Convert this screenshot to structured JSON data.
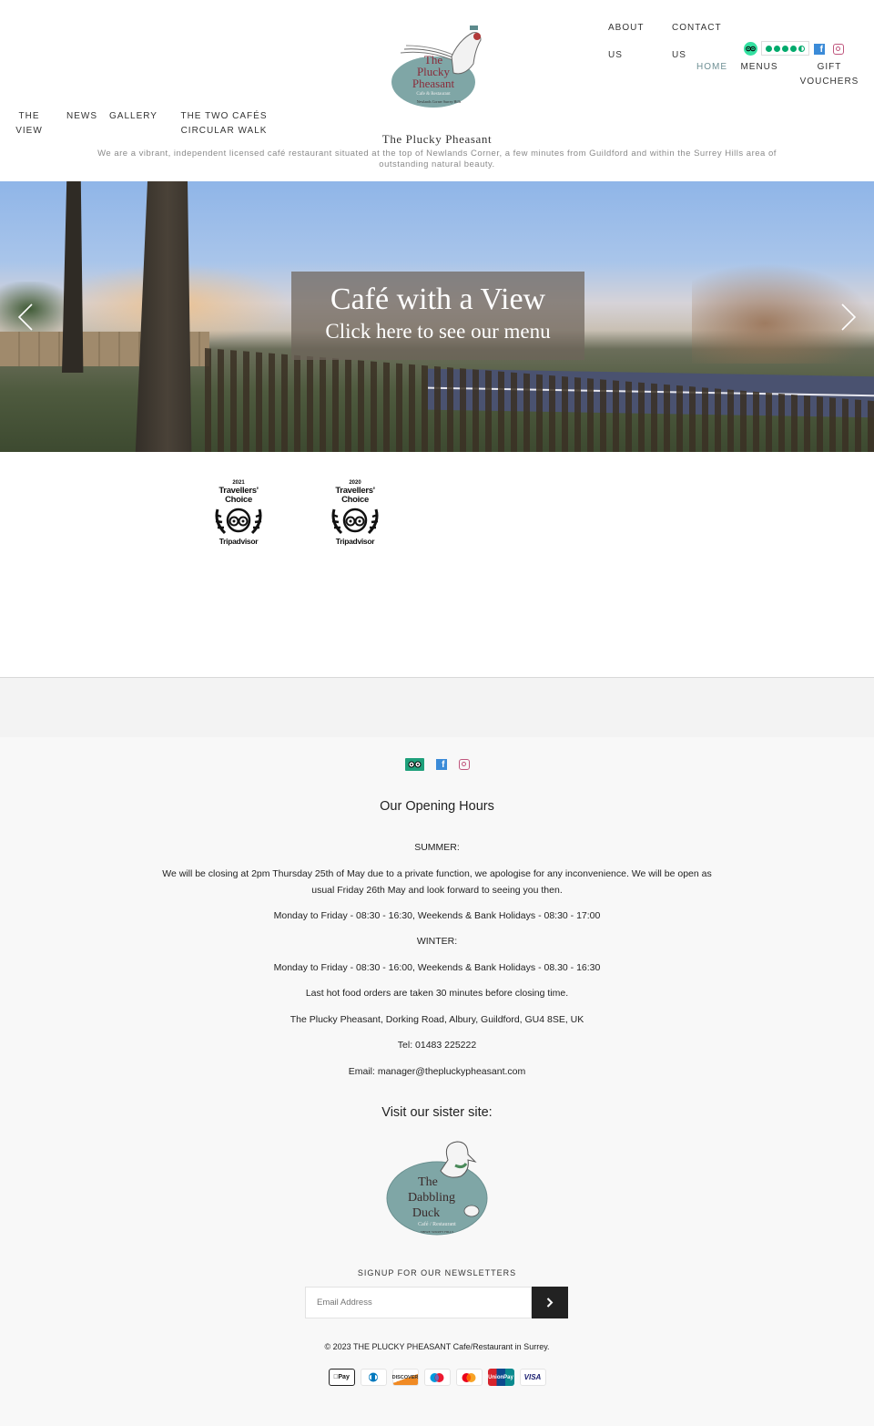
{
  "header": {
    "site_title": "The Plucky Pheasant",
    "description": "We are a vibrant, independent licensed café restaurant situated at the top of Newlands Corner, a few minutes from Guildford and within the Surrey Hills area of outstanding natural beauty.",
    "logo_alt": "The Plucky Pheasant Cafe & Restaurant",
    "nav_left": [
      {
        "line1": "THE",
        "line2": "VIEW"
      },
      {
        "line1": "NEWS",
        "line2": ""
      },
      {
        "line1": "GALLERY",
        "line2": ""
      },
      {
        "line1": "THE TWO CAFÉS",
        "line2": "CIRCULAR WALK"
      }
    ],
    "nav_right_top": [
      {
        "line1": "ABOUT",
        "line2": "US"
      },
      {
        "line1": "CONTACT",
        "line2": "US"
      }
    ],
    "nav_right_bottom": [
      {
        "line1": "HOME",
        "line2": "",
        "active": true
      },
      {
        "line1": "MENUS",
        "line2": ""
      },
      {
        "line1": "GIFT",
        "line2": "VOUCHERS"
      }
    ],
    "tripadvisor_rating": 4.5,
    "tripadvisor_rating_max": 5,
    "social_icons": [
      "tripadvisor-icon",
      "facebook-icon",
      "instagram-icon"
    ],
    "accent_color": "#6e8f94"
  },
  "hero": {
    "title": "Café with a View",
    "subtitle": "Click here to see our menu",
    "prev_label": "Previous slide",
    "next_label": "Next slide"
  },
  "awards": [
    {
      "year": "2021",
      "title_line1": "Travellers'",
      "title_line2": "Choice",
      "brand": "Tripadvisor"
    },
    {
      "year": "2020",
      "title_line1": "Travellers'",
      "title_line2": "Choice",
      "brand": "Tripadvisor"
    }
  ],
  "footer": {
    "opening_heading": "Our Opening Hours",
    "summer_label": "SUMMER:",
    "notice": "We will be closing at 2pm Thursday 25th of May due to a private function, we apologise for any inconvenience. We will be open as usual Friday 26th May and look forward to seeing you then.",
    "summer_hours": "Monday to Friday - 08:30 - 16:30, Weekends & Bank Holidays - 08:30 - 17:00",
    "winter_label": "WINTER:",
    "winter_hours": "Monday to Friday - 08:30 - 16:00, Weekends & Bank Holidays - 08.30 - 16:30",
    "last_orders": "Last hot food orders are taken 30 minutes before closing time.",
    "address": "The Plucky Pheasant, Dorking Road, Albury, Guildford, GU4 8SE, UK",
    "tel": "Tel: 01483 225222",
    "email": "Email: manager@thepluckypheasant.com",
    "sister_heading": "Visit our sister site:",
    "sister_logo_alt": "The Dabbling Duck Cafe / Restaurant",
    "newsletter_title": "SIGNUP FOR OUR NEWSLETTERS",
    "newsletter_placeholder": "Email Address",
    "copyright": "© 2023 THE PLUCKY PHEASANT Cafe/Restaurant in Surrey.",
    "payments": [
      "Pay",
      "",
      "DISCOVER",
      "",
      "",
      "UnionPay",
      "VISA"
    ]
  }
}
